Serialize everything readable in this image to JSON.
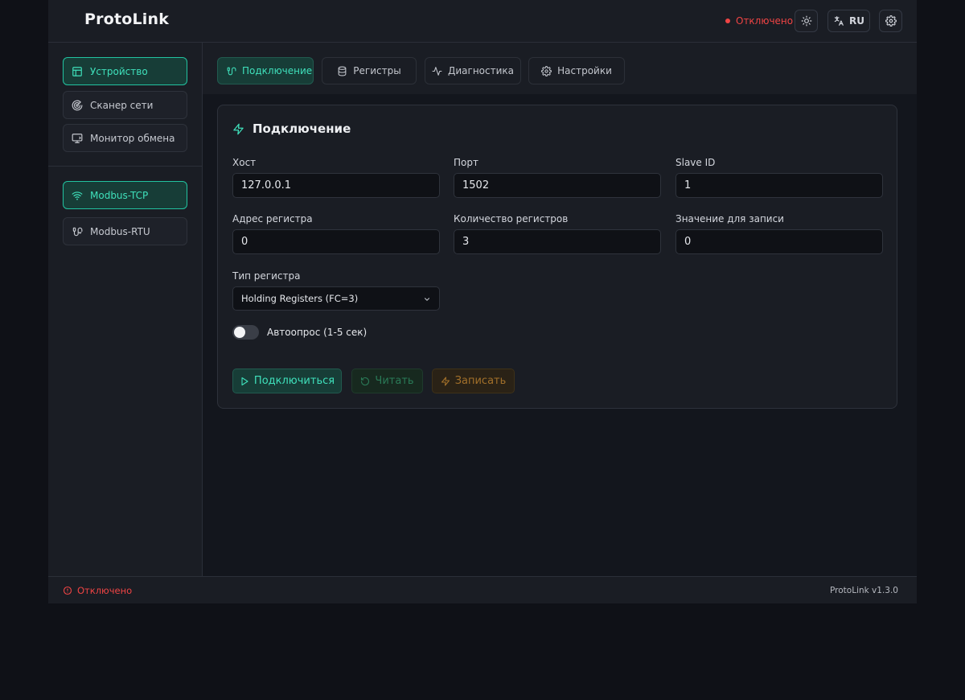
{
  "app": {
    "title": "ProtoLink",
    "version": "ProtoLink v1.3.0"
  },
  "header": {
    "status": "Отключено",
    "status_color": "#ef4444",
    "lang": "RU",
    "icons": {
      "theme": "sun-icon",
      "lang": "translate-icon",
      "settings": "gear-icon"
    }
  },
  "sidebar": {
    "nav": [
      {
        "label": "Устройство",
        "icon": "panel-layout-icon",
        "active": true
      },
      {
        "label": "Сканер сети",
        "icon": "radar-icon",
        "active": false
      },
      {
        "label": "Монитор обмена",
        "icon": "monitor-icon",
        "active": false
      }
    ],
    "protocols": [
      {
        "label": "Modbus-TCP",
        "icon": "wifi-icon",
        "active": true
      },
      {
        "label": "Modbus-RTU",
        "icon": "cable-icon",
        "active": false
      }
    ]
  },
  "tabs": [
    {
      "label": "Подключение",
      "icon": "plug-icon",
      "active": true
    },
    {
      "label": "Регистры",
      "icon": "database-icon",
      "active": false
    },
    {
      "label": "Диагностика",
      "icon": "activity-icon",
      "active": false
    },
    {
      "label": "Настройки",
      "icon": "gear-icon",
      "active": false
    }
  ],
  "card": {
    "title": "Подключение",
    "fields": {
      "host": {
        "label": "Хост",
        "value": "127.0.0.1"
      },
      "port": {
        "label": "Порт",
        "value": "1502"
      },
      "slave_id": {
        "label": "Slave ID",
        "value": "1"
      },
      "register_address": {
        "label": "Адрес регистра",
        "value": "0"
      },
      "register_count": {
        "label": "Количество регистров",
        "value": "3"
      },
      "write_value": {
        "label": "Значение для записи",
        "value": "0"
      }
    },
    "register_type": {
      "label": "Тип регистра",
      "selected": "Holding Registers (FC=3)"
    },
    "autopoll": {
      "label": "Автоопрос (1-5 сек)",
      "enabled": false
    },
    "buttons": {
      "connect": "Подключиться",
      "read": "Читать",
      "write": "Записать"
    }
  },
  "footer": {
    "status": "Отключено"
  },
  "colors": {
    "accent": "#3fe0bb",
    "danger": "#ef4444",
    "warning": "#a2702a"
  }
}
